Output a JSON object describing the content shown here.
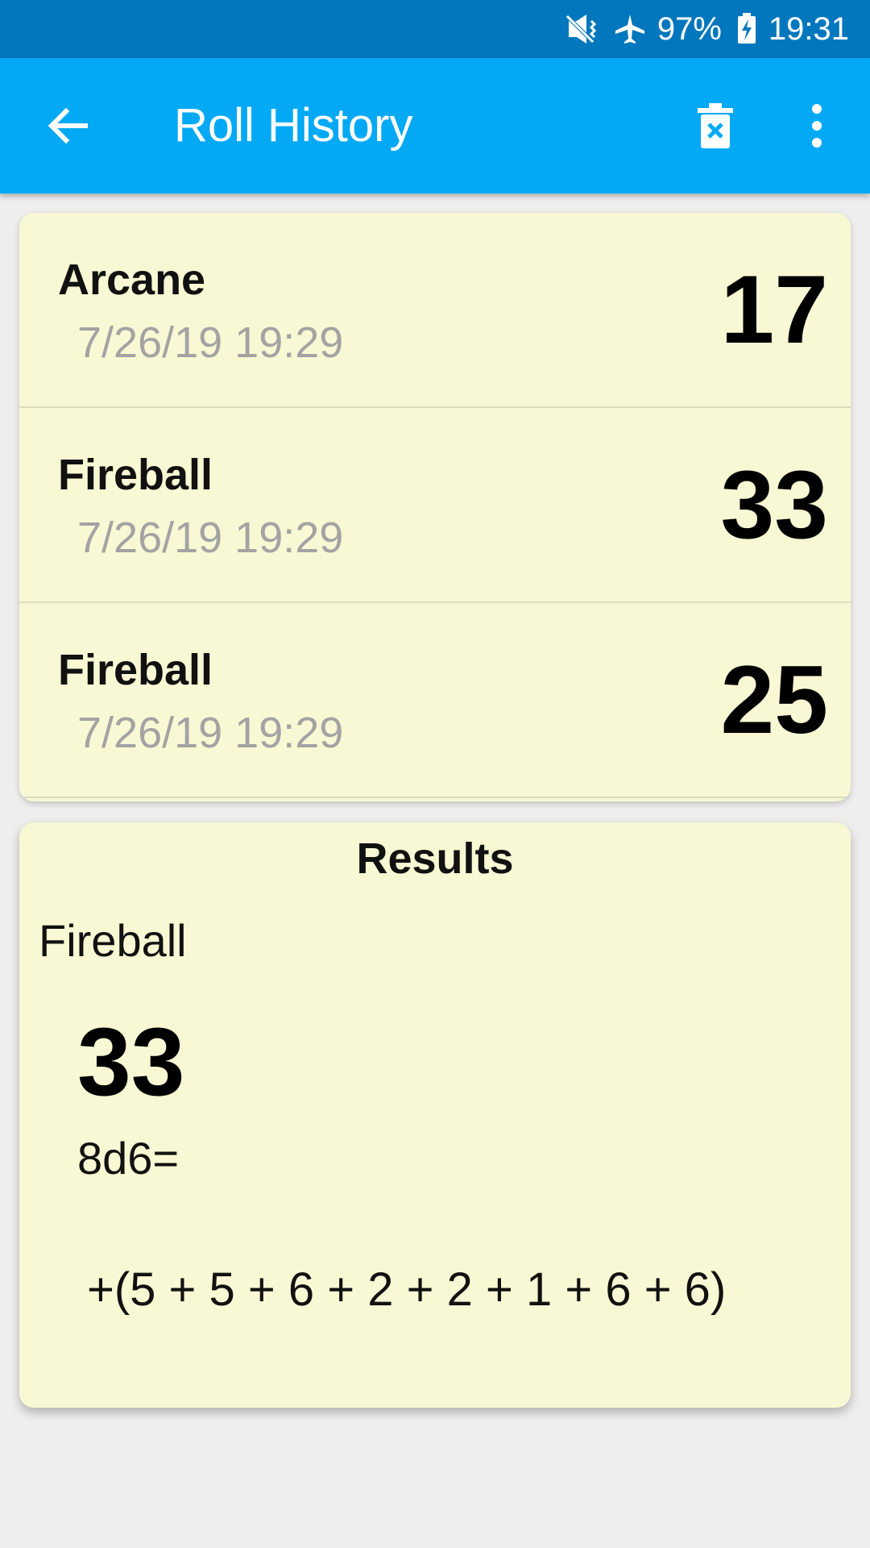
{
  "status_bar": {
    "battery": "97%",
    "time": "19:31",
    "icons": [
      "vibrate-mute-icon",
      "airplane-mode-icon",
      "battery-charging-icon"
    ]
  },
  "app_bar": {
    "title": "Roll History",
    "icons": [
      "back-arrow-icon",
      "delete-history-icon",
      "overflow-menu-icon"
    ]
  },
  "history": [
    {
      "name": "Arcane",
      "time": "7/26/19 19:29",
      "total": "17"
    },
    {
      "name": "Fireball",
      "time": "7/26/19 19:29",
      "total": "33"
    },
    {
      "name": "Fireball",
      "time": "7/26/19 19:29",
      "total": "25"
    }
  ],
  "results": {
    "title": "Results",
    "name": "Fireball",
    "total": "33",
    "formula": "8d6=",
    "breakdown": "+(5 + 5 + 6 + 2 + 2 + 1 + 6 + 6)"
  },
  "colors": {
    "status_bar": "#0277bd",
    "app_bar": "#03a9f4",
    "card_background": "#f8f8d4",
    "page_background": "#eeeeee",
    "timestamp_text": "#a3a3a3"
  }
}
